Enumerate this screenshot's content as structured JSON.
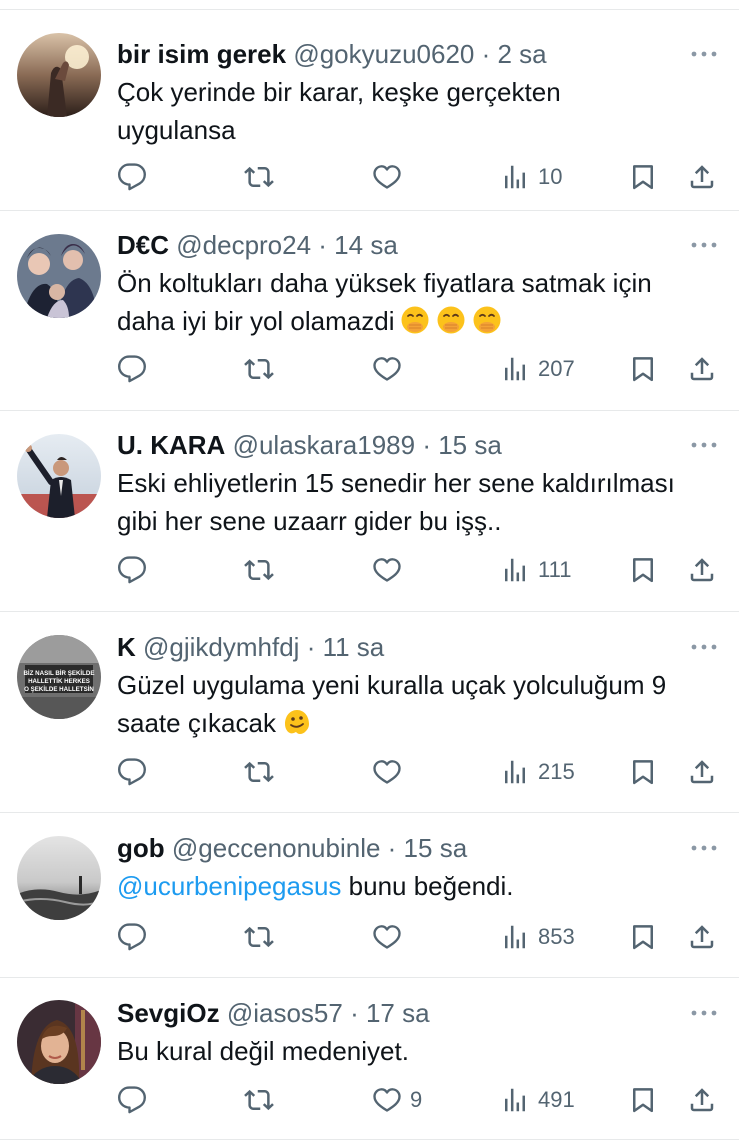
{
  "tweets": [
    {
      "display_name": "bir isim gerek",
      "handle": "@gokyuzu0620",
      "time": "2 sa",
      "text_lines": [
        "Çok yerinde bir karar, keşke gerçekten",
        "uygulansa"
      ],
      "mention": "",
      "after_mention": "",
      "emojis": [],
      "likes": "",
      "views": "10",
      "avatar": "sunset-hand"
    },
    {
      "display_name": "D€C",
      "handle": "@decpro24",
      "time": "14 sa",
      "text_lines": [
        "Ön koltukları daha yüksek fiyatlara satmak için",
        "daha iyi bir yol olamazdi"
      ],
      "mention": "",
      "after_mention": "",
      "emojis": [
        "face-with-hand-over-mouth",
        "face-with-hand-over-mouth",
        "face-with-hand-over-mouth"
      ],
      "likes": "",
      "views": "207",
      "avatar": "illustrated-group"
    },
    {
      "display_name": "U. KARA",
      "handle": "@ulaskara1989",
      "time": "15 sa",
      "text_lines": [
        "Eski ehliyetlerin 15 senedir her sene kaldırılması",
        "gibi her sene uzaarr gider bu işş.."
      ],
      "mention": "",
      "after_mention": "",
      "emojis": [],
      "likes": "",
      "views": "111",
      "avatar": "man-waving"
    },
    {
      "display_name": "K",
      "handle": "@gjikdymhfdj",
      "time": "11 sa",
      "text_lines": [
        "Güzel uygulama yeni kuralla uçak yolculuğum 9",
        "saate çıkacak"
      ],
      "mention": "",
      "after_mention": "",
      "emojis": [
        "melting-face"
      ],
      "likes": "",
      "views": "215",
      "avatar": "sign-board",
      "avatar_sign": [
        "BİZ NASIL BİR ŞEKİLDE",
        "HALLETTİK HERKES",
        "O ŞEKİLDE HALLETSİN"
      ]
    },
    {
      "display_name": "gob",
      "handle": "@geccenonubinle",
      "time": "15 sa",
      "text_lines": [],
      "mention": "@ucurbenipegasus",
      "after_mention": " bunu beğendi.",
      "emojis": [],
      "likes": "",
      "views": "853",
      "avatar": "grey-sea"
    },
    {
      "display_name": "SevgiOz",
      "handle": "@iasos57",
      "time": "17 sa",
      "text_lines": [
        "Bu kural değil medeniyet."
      ],
      "mention": "",
      "after_mention": "",
      "emojis": [],
      "likes": "9",
      "views": "491",
      "avatar": "woman-portrait"
    }
  ],
  "colors": {
    "text": "#0f1419",
    "secondary": "#536471",
    "link": "#1d9bf0",
    "divider": "#e7e9ea"
  },
  "icons": {
    "reply": "reply-icon",
    "retweet": "retweet-icon",
    "like": "heart-icon",
    "views": "views-chart-icon",
    "bookmark": "bookmark-icon",
    "share": "share-icon",
    "more": "more-dots-icon"
  }
}
